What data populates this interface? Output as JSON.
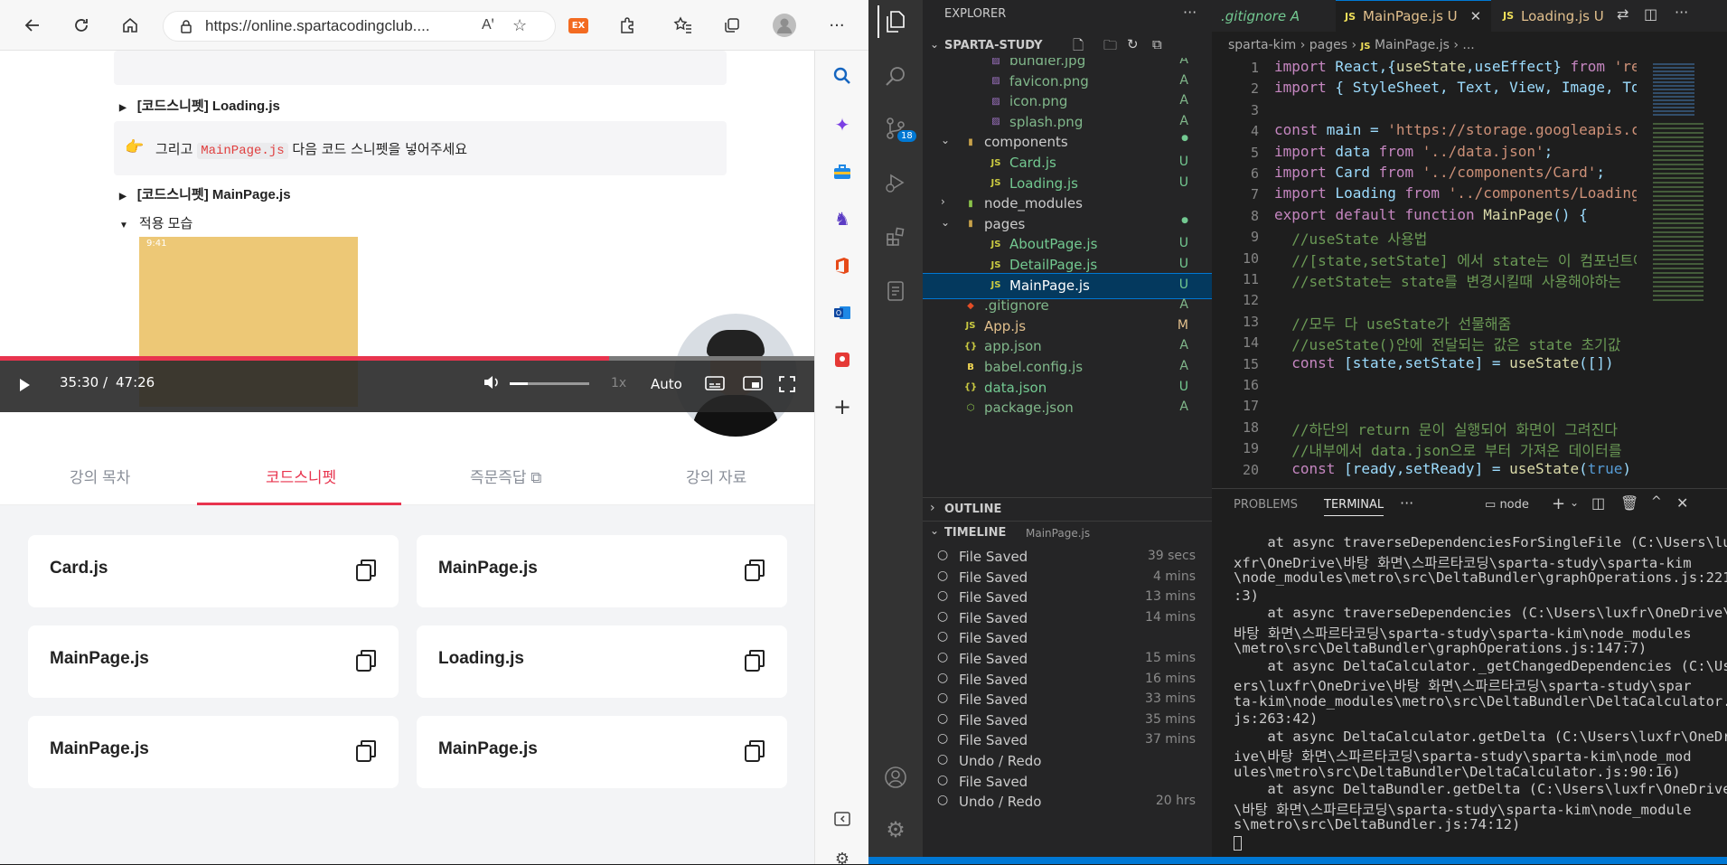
{
  "browser": {
    "url": "https://online.spartacodingclub....",
    "toolbar_icons": [
      "back-arrow-icon",
      "refresh-icon",
      "home-icon",
      "lock-icon",
      "read-aloud-icon",
      "favorite-add-icon",
      "extension-ex-icon",
      "extensions-icon",
      "favorites-icon",
      "collections-icon",
      "profile-icon",
      "more-icon"
    ],
    "ext_label": "EX",
    "more_label": "···"
  },
  "page": {
    "toggle1": "[코드스니펫] Loading.js",
    "note_pre": "그리고",
    "note_code": "MainPage.js",
    "note_post": "다음 코드 스니펫을 넣어주세요",
    "note_emoji": "👉",
    "toggle2": "[코드스니펫] MainPage.js",
    "toggle3": "적용 모습",
    "phone_time": "9:41"
  },
  "player": {
    "current": "35:30 /",
    "total": "47:26",
    "speed": "1x",
    "quality": "Auto",
    "progress": 0.748
  },
  "tabs": [
    "강의 목차",
    "코드스니펫",
    "즉문즉답",
    "강의 자료"
  ],
  "cards": [
    "Card.js",
    "MainPage.js",
    "MainPage.js",
    "Loading.js",
    "MainPage.js",
    "MainPage.js"
  ],
  "vscode": {
    "explorer_title": "EXPLORER",
    "project": "SPARTA-STUDY",
    "badge": "18",
    "files": [
      {
        "name": "bundler.jpg",
        "status": "A",
        "indent": 2,
        "type": "img"
      },
      {
        "name": "favicon.png",
        "status": "A",
        "indent": 2,
        "type": "img"
      },
      {
        "name": "icon.png",
        "status": "A",
        "indent": 2,
        "type": "img"
      },
      {
        "name": "splash.png",
        "status": "A",
        "indent": 2,
        "type": "img"
      },
      {
        "name": "components",
        "status": "●",
        "indent": 1,
        "type": "folder-open"
      },
      {
        "name": "Card.js",
        "status": "U",
        "indent": 2,
        "type": "js"
      },
      {
        "name": "Loading.js",
        "status": "U",
        "indent": 2,
        "type": "js"
      },
      {
        "name": "node_modules",
        "status": "",
        "indent": 1,
        "type": "folder"
      },
      {
        "name": "pages",
        "status": "●",
        "indent": 1,
        "type": "folder-open"
      },
      {
        "name": "AboutPage.js",
        "status": "U",
        "indent": 2,
        "type": "js"
      },
      {
        "name": "DetailPage.js",
        "status": "U",
        "indent": 2,
        "type": "js"
      },
      {
        "name": "MainPage.js",
        "status": "U",
        "indent": 2,
        "type": "js"
      },
      {
        "name": ".gitignore",
        "status": "A",
        "indent": 1,
        "type": "git"
      },
      {
        "name": "App.js",
        "status": "M",
        "indent": 1,
        "type": "js"
      },
      {
        "name": "app.json",
        "status": "A",
        "indent": 1,
        "type": "json"
      },
      {
        "name": "babel.config.js",
        "status": "A",
        "indent": 1,
        "type": "babel"
      },
      {
        "name": "data.json",
        "status": "U",
        "indent": 1,
        "type": "json"
      },
      {
        "name": "package.json",
        "status": "A",
        "indent": 1,
        "type": "pkg"
      }
    ],
    "outline": "OUTLINE",
    "timeline": "TIMELINE",
    "timeline_file": "MainPage.js",
    "timeline_items": [
      {
        "label": "File Saved",
        "time": "39 secs"
      },
      {
        "label": "File Saved",
        "time": "4 mins"
      },
      {
        "label": "File Saved",
        "time": "13 mins"
      },
      {
        "label": "File Saved",
        "time": "14 mins"
      },
      {
        "label": "File Saved",
        "time": ""
      },
      {
        "label": "File Saved",
        "time": "15 mins"
      },
      {
        "label": "File Saved",
        "time": "16 mins"
      },
      {
        "label": "File Saved",
        "time": "33 mins"
      },
      {
        "label": "File Saved",
        "time": "35 mins"
      },
      {
        "label": "File Saved",
        "time": "37 mins"
      },
      {
        "label": "Undo / Redo",
        "time": ""
      },
      {
        "label": "File Saved",
        "time": ""
      },
      {
        "label": "Undo / Redo",
        "time": "20 hrs"
      }
    ],
    "editor_tabs": [
      {
        "name": ".gitignore",
        "status": "A"
      },
      {
        "name": "MainPage.js",
        "status": "U"
      },
      {
        "name": "Loading.js",
        "status": "U"
      }
    ],
    "breadcrumb": [
      "sparta-kim",
      "pages",
      "MainPage.js",
      "..."
    ],
    "code_lines": [
      {
        "n": "1",
        "t": "import React,{useState,useEffect} from 'react"
      },
      {
        "n": "2",
        "t": "import { StyleSheet, Text, View, Image, Touch"
      },
      {
        "n": "3",
        "t": ""
      },
      {
        "n": "4",
        "t": "const main = 'https://storage.googleapis.com/"
      },
      {
        "n": "5",
        "t": "import data from '../data.json';"
      },
      {
        "n": "6",
        "t": "import Card from '../components/Card';"
      },
      {
        "n": "7",
        "t": "import Loading from '../components/Loading';"
      },
      {
        "n": "8",
        "t": "export default function MainPage() {"
      },
      {
        "n": "9",
        "t": "  //useState 사용법"
      },
      {
        "n": "10",
        "t": "  //[state,setState] 에서 state는 이 컴포넌트에"
      },
      {
        "n": "11",
        "t": "  //setState는 state를 변경시킬때 사용해야하는"
      },
      {
        "n": "12",
        "t": ""
      },
      {
        "n": "13",
        "t": "  //모두 다 useState가 선물해줌"
      },
      {
        "n": "14",
        "t": "  //useState()안에 전달되는 값은 state 초기값"
      },
      {
        "n": "15",
        "t": "  const [state,setState] = useState([])"
      },
      {
        "n": "16",
        "t": ""
      },
      {
        "n": "17",
        "t": ""
      },
      {
        "n": "18",
        "t": "  //하단의 return 문이 실행되어 화면이 그려진다"
      },
      {
        "n": "19",
        "t": "  //내부에서 data.json으로 부터 가져온 데이터를"
      },
      {
        "n": "20",
        "t": "  const [ready,setReady] = useState(true)"
      }
    ],
    "panel_tabs": [
      "PROBLEMS",
      "TERMINAL"
    ],
    "terminal_name": "node",
    "terminal_lines": [
      "    at async traverseDependenciesForSingleFile (C:\\Users\\lu",
      "xfr\\OneDrive\\바탕 화면\\스파르타코딩\\sparta-study\\sparta-kim",
      "\\node_modules\\metro\\src\\DeltaBundler\\graphOperations.js:221",
      ":3)",
      "    at async traverseDependencies (C:\\Users\\luxfr\\OneDrive\\",
      "바탕 화면\\스파르타코딩\\sparta-study\\sparta-kim\\node_modules",
      "\\metro\\src\\DeltaBundler\\graphOperations.js:147:7)",
      "    at async DeltaCalculator._getChangedDependencies (C:\\Us",
      "ers\\luxfr\\OneDrive\\바탕 화면\\스파르타코딩\\sparta-study\\spar",
      "ta-kim\\node_modules\\metro\\src\\DeltaBundler\\DeltaCalculator.",
      "js:263:42)",
      "    at async DeltaCalculator.getDelta (C:\\Users\\luxfr\\OneDr",
      "ive\\바탕 화면\\스파르타코딩\\sparta-study\\sparta-kim\\node_mod",
      "ules\\metro\\src\\DeltaBundler\\DeltaCalculator.js:90:16)",
      "    at async DeltaBundler.getDelta (C:\\Users\\luxfr\\OneDrive",
      "\\바탕 화면\\스파르타코딩\\sparta-study\\sparta-kim\\node_module",
      "s\\metro\\src\\DeltaBundler.js:74:12)"
    ]
  }
}
